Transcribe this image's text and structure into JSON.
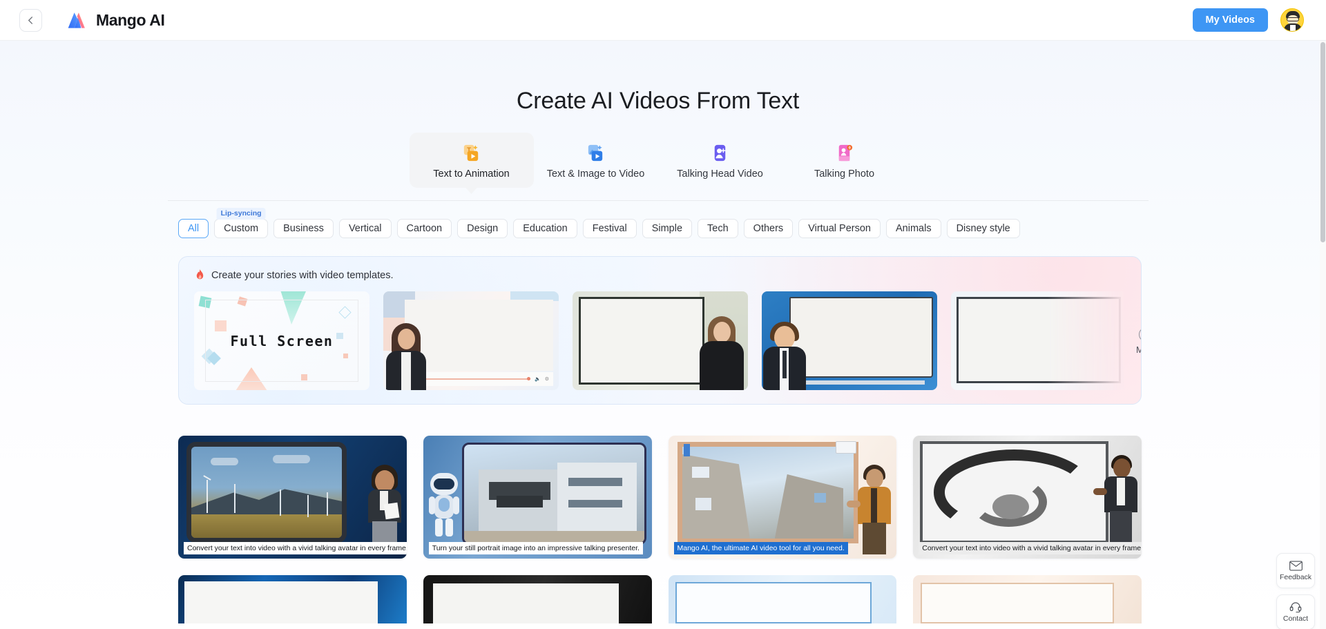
{
  "header": {
    "back_icon": "chevron-left-icon",
    "brand_name": "Mango AI",
    "logo_icon": "mango-ai-logo",
    "my_videos_label": "My Videos",
    "avatar_icon": "user-avatar"
  },
  "main": {
    "page_title": "Create AI Videos From Text",
    "modes": [
      {
        "label": "Text to Animation",
        "icon": "text-to-animation-icon",
        "active": true
      },
      {
        "label": "Text & Image to Video",
        "icon": "text-image-to-video-icon",
        "active": false
      },
      {
        "label": "Talking Head Video",
        "icon": "talking-head-video-icon",
        "active": false
      },
      {
        "label": "Talking Photo",
        "icon": "talking-photo-icon",
        "active": false
      }
    ],
    "categories": [
      {
        "label": "All",
        "active": true
      },
      {
        "label": "Custom",
        "active": false,
        "badge": "Lip-syncing"
      },
      {
        "label": "Business",
        "active": false
      },
      {
        "label": "Vertical",
        "active": false
      },
      {
        "label": "Cartoon",
        "active": false
      },
      {
        "label": "Design",
        "active": false
      },
      {
        "label": "Education",
        "active": false
      },
      {
        "label": "Festival",
        "active": false
      },
      {
        "label": "Simple",
        "active": false
      },
      {
        "label": "Tech",
        "active": false
      },
      {
        "label": "Others",
        "active": false
      },
      {
        "label": "Virtual Person",
        "active": false
      },
      {
        "label": "Animals",
        "active": false
      },
      {
        "label": "Disney style",
        "active": false
      }
    ]
  },
  "promo": {
    "icon": "fire-icon",
    "title": "Create your stories with video templates.",
    "more_label": "More",
    "more_icon": "chevron-right-circle-icon",
    "thumbs": [
      {
        "name": "full-screen-template",
        "text": "Full Screen"
      },
      {
        "name": "female-presenter-player-template",
        "text": ""
      },
      {
        "name": "dark-frame-presenter-template",
        "text": ""
      },
      {
        "name": "blue-screen-male-presenter-template",
        "text": ""
      },
      {
        "name": "plain-frame-template",
        "text": ""
      }
    ]
  },
  "grid": {
    "cards": [
      {
        "name": "wind-turbine-avatar-template",
        "caption": "Convert your text into video with a vivid talking avatar in every frame.",
        "caption_style": "white"
      },
      {
        "name": "robot-house-template",
        "caption": "Turn your still portrait image into an impressive talking presenter.",
        "caption_style": "white"
      },
      {
        "name": "castle-presenter-template",
        "caption": "Mango AI, the ultimate AI video tool for all you need.",
        "caption_style": "blue"
      },
      {
        "name": "spiral-staircase-template",
        "caption": "Convert your text into video with a vivid talking avatar in every frame.",
        "caption_style": "grey"
      }
    ]
  },
  "side_tools": [
    {
      "label": "Feedback",
      "icon": "envelope-icon"
    },
    {
      "label": "Contact",
      "icon": "headset-icon"
    }
  ],
  "colors": {
    "accent_blue": "#3e96f4",
    "chip_active_border": "#5aa8f7",
    "badge_bg": "#eaf2fe",
    "badge_text": "#3e79d8"
  }
}
